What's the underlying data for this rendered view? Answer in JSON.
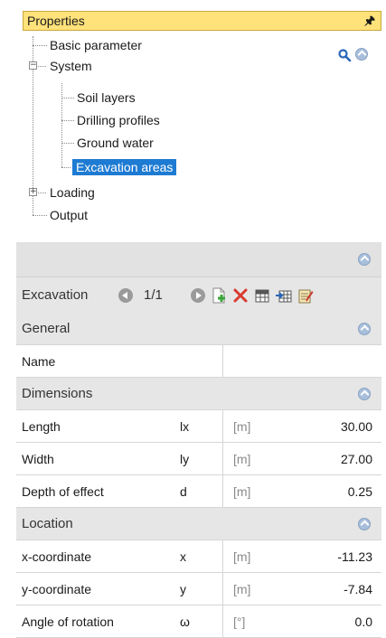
{
  "properties": {
    "title": "Properties",
    "pin_icon": "pin-icon"
  },
  "tree": {
    "items": [
      {
        "label": "Basic parameter"
      },
      {
        "label": "System",
        "expanded": true
      },
      {
        "label": "Soil layers"
      },
      {
        "label": "Drilling profiles"
      },
      {
        "label": "Ground water"
      },
      {
        "label": "Excavation areas",
        "selected": true
      },
      {
        "label": "Loading",
        "expanded": false
      },
      {
        "label": "Output"
      }
    ],
    "toggle_expanded": "−",
    "toggle_collapsed": "+"
  },
  "toolbar": {
    "label": "Excavation",
    "page": "1/1",
    "tools": [
      "add-icon",
      "delete-icon",
      "table-icon",
      "table-import-icon",
      "edit-icon"
    ]
  },
  "sections": {
    "general": {
      "title": "General",
      "name_label": "Name",
      "name_value": ""
    },
    "dimensions": {
      "title": "Dimensions",
      "rows": [
        {
          "name": "Length",
          "sym": "lx",
          "unit": "[m]",
          "value": "30.00"
        },
        {
          "name": "Width",
          "sym": "ly",
          "unit": "[m]",
          "value": "27.00"
        },
        {
          "name": "Depth of effect",
          "sym": "d",
          "unit": "[m]",
          "value": "0.25"
        }
      ]
    },
    "location": {
      "title": "Location",
      "rows": [
        {
          "name": "x-coordinate",
          "sym": "x",
          "unit": "[m]",
          "value": "-11.23"
        },
        {
          "name": "y-coordinate",
          "sym": "y",
          "unit": "[m]",
          "value": "-7.84"
        },
        {
          "name": "Angle of rotation",
          "sym": "ω",
          "unit": "[°]",
          "value": "0.0"
        }
      ]
    }
  },
  "colors": {
    "header": "#ffe27a",
    "selection": "#1e7bd3",
    "section_bg": "#e6e6e6"
  }
}
